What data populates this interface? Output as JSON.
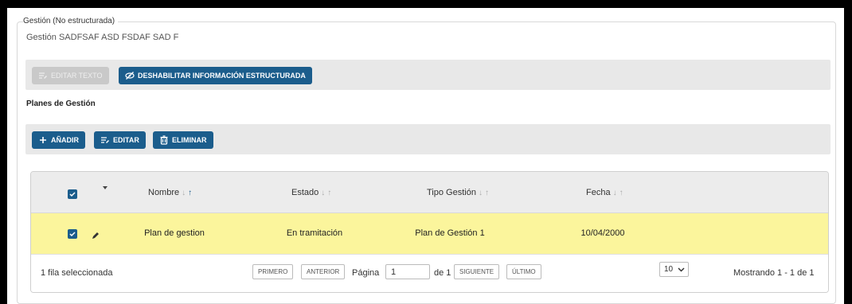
{
  "fieldset": {
    "legend": "Gestión (No estructurada)",
    "text": "Gestión SADFSAF ASD FSDAF SAD F"
  },
  "toolbar1": {
    "edit_text_label": "EDITAR TEXTO",
    "disable_structured_label": "DESHABILITAR INFORMACIÓN ESTRUCTURADA"
  },
  "section": {
    "title": "Planes de Gestión"
  },
  "toolbar2": {
    "add_label": "AÑADIR",
    "edit_label": "EDITAR",
    "delete_label": "ELIMINAR"
  },
  "grid": {
    "columns": {
      "nombre": "Nombre",
      "estado": "Estado",
      "tipo": "Tipo Gestión",
      "fecha": "Fecha"
    },
    "rows": [
      {
        "nombre": "Plan de gestion",
        "estado": "En tramitación",
        "tipo": "Plan de Gestión 1",
        "fecha": "10/04/2000"
      }
    ],
    "footer": {
      "selected": "1 fila seleccionada",
      "first": "PRIMERO",
      "prev": "ANTERIOR",
      "page_label": "Página",
      "page_value": "1",
      "of": "de 1",
      "next": "SIGUIENTE",
      "last": "ÚLTIMO",
      "page_size": "10",
      "showing": "Mostrando 1 - 1 de 1"
    }
  },
  "colors": {
    "primary": "#1b5d8c",
    "selected_row": "#fbf59c"
  }
}
